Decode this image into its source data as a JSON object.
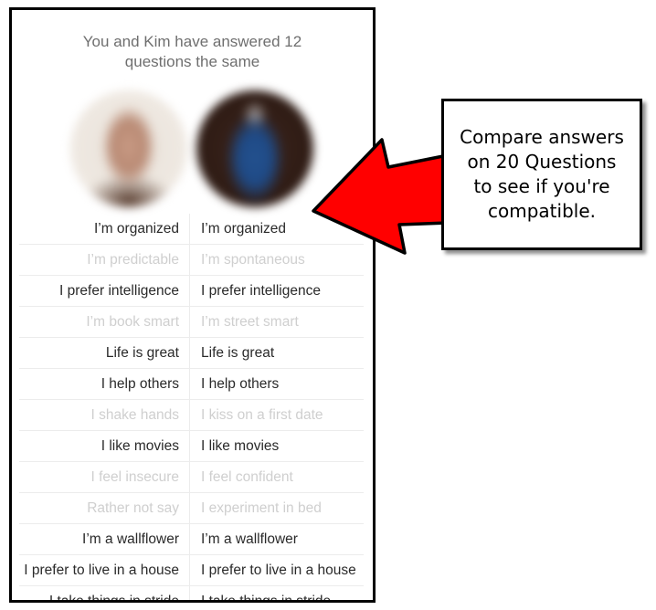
{
  "header": {
    "title_line1": "You and Kim have answered 12",
    "title_line2": "questions the same"
  },
  "avatars": {
    "you": "user-avatar",
    "kim": "kim-avatar"
  },
  "answers": [
    {
      "you": "I’m organized",
      "kim": "I’m organized",
      "match": true
    },
    {
      "you": "I’m predictable",
      "kim": "I’m spontaneous",
      "match": false
    },
    {
      "you": "I prefer intelligence",
      "kim": "I prefer intelligence",
      "match": true
    },
    {
      "you": "I’m book smart",
      "kim": "I’m street smart",
      "match": false
    },
    {
      "you": "Life is great",
      "kim": "Life is great",
      "match": true
    },
    {
      "you": "I help others",
      "kim": "I help others",
      "match": true
    },
    {
      "you": "I shake hands",
      "kim": "I kiss on a first date",
      "match": false
    },
    {
      "you": "I like movies",
      "kim": "I like movies",
      "match": true
    },
    {
      "you": "I feel insecure",
      "kim": "I feel confident",
      "match": false
    },
    {
      "you": "Rather not say",
      "kim": "I experiment in bed",
      "match": false
    },
    {
      "you": "I’m a wallflower",
      "kim": "I’m a wallflower",
      "match": true
    },
    {
      "you": "I prefer to live in a house",
      "kim": "I prefer to live in a house",
      "match": true
    },
    {
      "you": "I take things in stride",
      "kim": "I take things in stride",
      "match": true
    }
  ],
  "callout": {
    "line1": "Compare answers",
    "line2": "on 20 Questions",
    "line3": "to see if you're",
    "line4": "compatible."
  },
  "colors": {
    "arrow_fill": "#ff0000",
    "match_text": "#2a2a2a",
    "nomatch_text": "#cfcfcf",
    "header_text": "#6f6f6f"
  }
}
